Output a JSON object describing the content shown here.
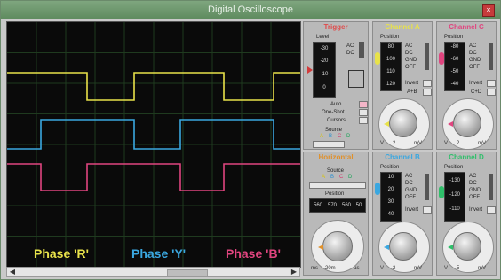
{
  "window": {
    "title": "Digital Oscilloscope",
    "close_label": "×"
  },
  "phases": [
    {
      "label": "Phase 'R'",
      "color": "#e8e24a"
    },
    {
      "label": "Phase 'Y'",
      "color": "#3aa7e0"
    },
    {
      "label": "Phase 'B'",
      "color": "#e0457f"
    }
  ],
  "trigger": {
    "title": "Trigger",
    "title_color": "#e04a4a",
    "level_label": "Level",
    "level_scale": [
      "-30",
      "-20",
      "-10",
      "0"
    ],
    "coupling": [
      "AC",
      "DC"
    ],
    "buttons": [
      "Auto",
      "One-Shot",
      "Cursors"
    ],
    "source_label": "Source",
    "source_channels": [
      "A",
      "B",
      "C",
      "D"
    ]
  },
  "channel_a": {
    "title": "Channel A",
    "title_color": "#e8e24a",
    "position_label": "Position",
    "position_scale": [
      "80",
      "100",
      "110",
      "120"
    ],
    "coupling": [
      "AC",
      "DC",
      "GND",
      "OFF"
    ],
    "invert": "Invert",
    "combo": "A+B",
    "dial_unit": "mV",
    "dial_left": "V",
    "dial_value": "2"
  },
  "channel_c": {
    "title": "Channel C",
    "title_color": "#e0457f",
    "position_label": "Position",
    "position_scale": [
      "-80",
      "-60",
      "-50",
      "-40"
    ],
    "coupling": [
      "AC",
      "DC",
      "GND",
      "OFF"
    ],
    "invert": "Invert",
    "combo": "C+D",
    "dial_unit": "mV",
    "dial_left": "V",
    "dial_value": "2"
  },
  "horizontal": {
    "title": "Horizontal",
    "title_color": "#e0902a",
    "source_label": "Source",
    "source_channels": [
      "A",
      "B",
      "C",
      "D"
    ],
    "position_label": "Position",
    "position_scale": [
      "560",
      "570",
      "560",
      "50"
    ],
    "dial_left": "ms",
    "dial_value": "20m",
    "dial_unit": "µs"
  },
  "channel_b": {
    "title": "Channel B",
    "title_color": "#3aa7e0",
    "position_label": "Position",
    "position_scale": [
      "10",
      "20",
      "30",
      "40"
    ],
    "coupling": [
      "AC",
      "DC",
      "GND",
      "OFF"
    ],
    "invert": "Invert",
    "dial_unit": "mV",
    "dial_left": "V",
    "dial_value": "2"
  },
  "channel_d": {
    "title": "Channel D",
    "title_color": "#2fbf6a",
    "position_label": "Position",
    "position_scale": [
      "-130",
      "-120",
      "-110"
    ],
    "coupling": [
      "AC",
      "DC",
      "GND",
      "OFF"
    ],
    "invert": "Invert",
    "dial_unit": "mV",
    "dial_left": "V",
    "dial_value": "5"
  },
  "scroll": {
    "left_arrow": "◀",
    "right_arrow": "▶"
  }
}
